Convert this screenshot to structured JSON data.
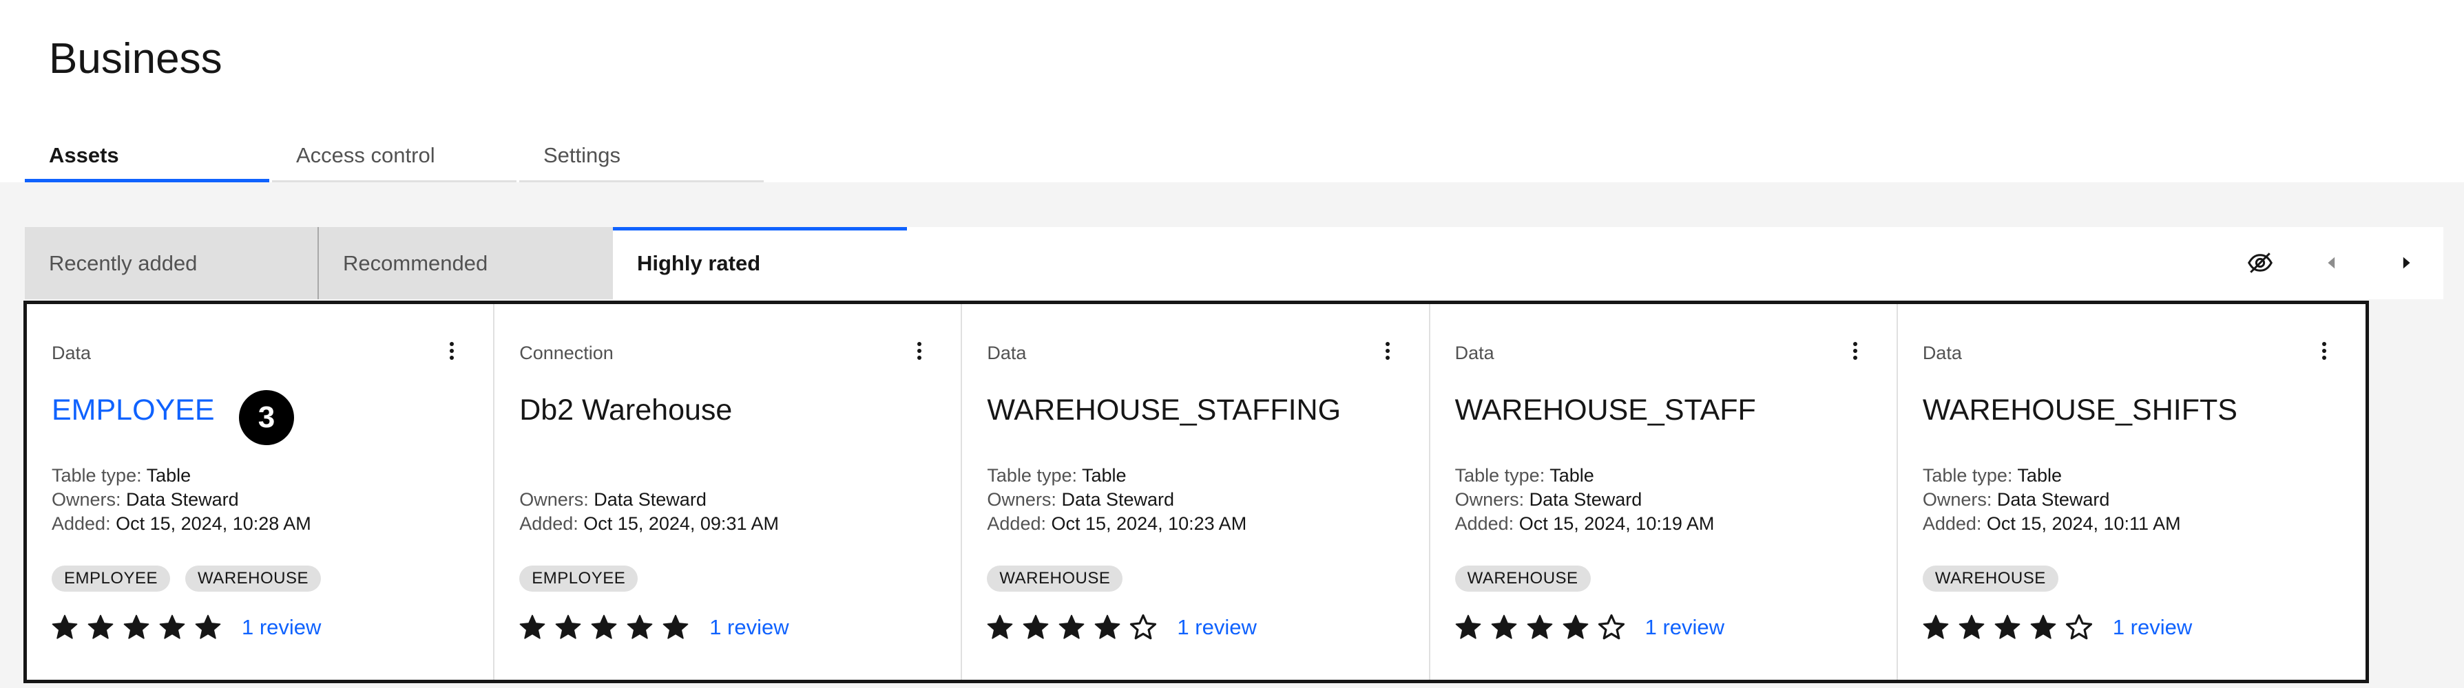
{
  "page": {
    "title": "Business"
  },
  "tabs": [
    {
      "label": "Assets",
      "active": true
    },
    {
      "label": "Access control",
      "active": false
    },
    {
      "label": "Settings",
      "active": false
    }
  ],
  "content_tabs": [
    {
      "label": "Recently added",
      "active": false
    },
    {
      "label": "Recommended",
      "active": false
    },
    {
      "label": "Highly rated",
      "active": true
    }
  ],
  "toolbar": {
    "icons": [
      "view-off-icon",
      "caret-left-icon",
      "caret-right-icon"
    ]
  },
  "overlay_badge": "3",
  "labels": {
    "table_type": "Table type:",
    "owners": "Owners:",
    "added": "Added:"
  },
  "cards": [
    {
      "type": "Data",
      "name": "EMPLOYEE",
      "name_is_link": true,
      "table_type": "Table",
      "owners": "Data Steward",
      "added": "Oct 15, 2024, 10:28 AM",
      "tags": [
        "EMPLOYEE",
        "WAREHOUSE"
      ],
      "rating": 5,
      "reviews": "1 review"
    },
    {
      "type": "Connection",
      "name": "Db2 Warehouse",
      "name_is_link": false,
      "table_type": null,
      "owners": "Data Steward",
      "added": "Oct 15, 2024, 09:31 AM",
      "tags": [
        "EMPLOYEE"
      ],
      "rating": 5,
      "reviews": "1 review"
    },
    {
      "type": "Data",
      "name": "WAREHOUSE_STAFFING",
      "name_is_link": false,
      "table_type": "Table",
      "owners": "Data Steward",
      "added": "Oct 15, 2024, 10:23 AM",
      "tags": [
        "WAREHOUSE"
      ],
      "rating": 4,
      "reviews": "1 review"
    },
    {
      "type": "Data",
      "name": "WAREHOUSE_STAFF",
      "name_is_link": false,
      "table_type": "Table",
      "owners": "Data Steward",
      "added": "Oct 15, 2024, 10:19 AM",
      "tags": [
        "WAREHOUSE"
      ],
      "rating": 4,
      "reviews": "1 review"
    },
    {
      "type": "Data",
      "name": "WAREHOUSE_SHIFTS",
      "name_is_link": false,
      "table_type": "Table",
      "owners": "Data Steward",
      "added": "Oct 15, 2024, 10:11 AM",
      "tags": [
        "WAREHOUSE"
      ],
      "rating": 4,
      "reviews": "1 review"
    }
  ],
  "colors": {
    "accent": "#0f62fe",
    "text": "#161616",
    "secondary_text": "#525252",
    "tag_bg": "#e0e0e0",
    "background": "#f4f4f4"
  }
}
